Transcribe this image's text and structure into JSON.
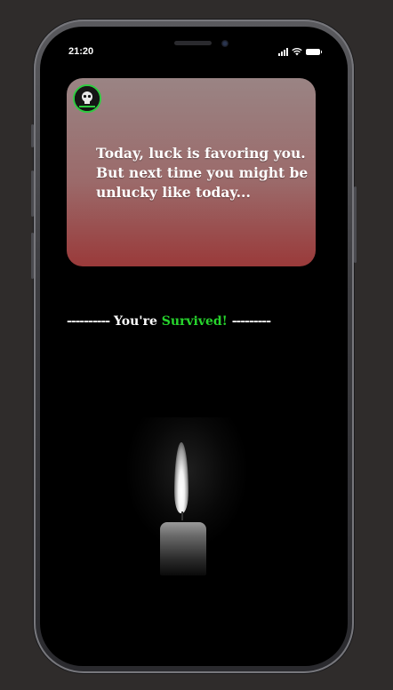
{
  "status_bar": {
    "time": "21:20",
    "icons": [
      "cellular-signal-icon",
      "wifi-icon",
      "battery-icon"
    ]
  },
  "message_card": {
    "avatar_icon": "skull-avatar-icon",
    "text": "Today, luck is favoring you. But next time you might be unlucky like today..."
  },
  "result": {
    "left_dashes": "----------",
    "prefix": "You're ",
    "highlight": "Survived!",
    "right_dashes": "---------"
  },
  "colors": {
    "background": "#000000",
    "highlight": "#27d52d",
    "card_top": "#9a8484",
    "card_bottom": "#9a3a3a"
  },
  "illustration": "candle-icon"
}
